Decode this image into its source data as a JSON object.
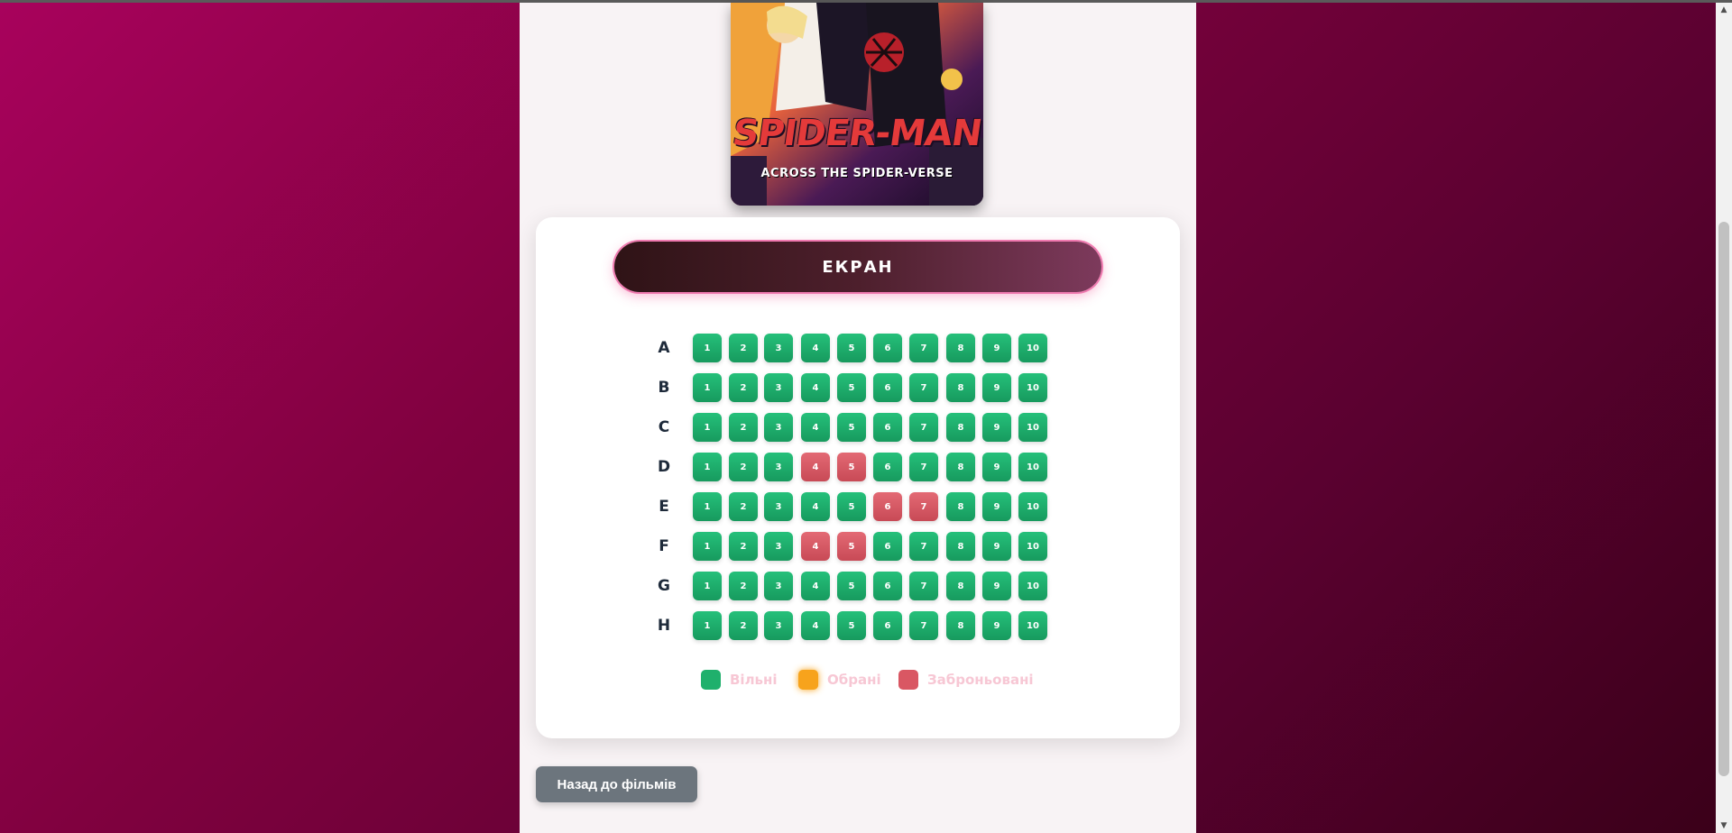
{
  "poster": {
    "title": "SPIDER-MAN",
    "subtitle": "ACROSS THE SPIDER-VERSE"
  },
  "screen_label": "ЕКРАН",
  "rows": [
    {
      "label": "A",
      "seats": [
        {
          "n": "1",
          "status": "free"
        },
        {
          "n": "2",
          "status": "free"
        },
        {
          "n": "3",
          "status": "free"
        },
        {
          "n": "4",
          "status": "free"
        },
        {
          "n": "5",
          "status": "free"
        },
        {
          "n": "6",
          "status": "free"
        },
        {
          "n": "7",
          "status": "free"
        },
        {
          "n": "8",
          "status": "free"
        },
        {
          "n": "9",
          "status": "free"
        },
        {
          "n": "10",
          "status": "free"
        }
      ]
    },
    {
      "label": "B",
      "seats": [
        {
          "n": "1",
          "status": "free"
        },
        {
          "n": "2",
          "status": "free"
        },
        {
          "n": "3",
          "status": "free"
        },
        {
          "n": "4",
          "status": "free"
        },
        {
          "n": "5",
          "status": "free"
        },
        {
          "n": "6",
          "status": "free"
        },
        {
          "n": "7",
          "status": "free"
        },
        {
          "n": "8",
          "status": "free"
        },
        {
          "n": "9",
          "status": "free"
        },
        {
          "n": "10",
          "status": "free"
        }
      ]
    },
    {
      "label": "C",
      "seats": [
        {
          "n": "1",
          "status": "free"
        },
        {
          "n": "2",
          "status": "free"
        },
        {
          "n": "3",
          "status": "free"
        },
        {
          "n": "4",
          "status": "free"
        },
        {
          "n": "5",
          "status": "free"
        },
        {
          "n": "6",
          "status": "free"
        },
        {
          "n": "7",
          "status": "free"
        },
        {
          "n": "8",
          "status": "free"
        },
        {
          "n": "9",
          "status": "free"
        },
        {
          "n": "10",
          "status": "free"
        }
      ]
    },
    {
      "label": "D",
      "seats": [
        {
          "n": "1",
          "status": "free"
        },
        {
          "n": "2",
          "status": "free"
        },
        {
          "n": "3",
          "status": "free"
        },
        {
          "n": "4",
          "status": "booked"
        },
        {
          "n": "5",
          "status": "booked"
        },
        {
          "n": "6",
          "status": "free"
        },
        {
          "n": "7",
          "status": "free"
        },
        {
          "n": "8",
          "status": "free"
        },
        {
          "n": "9",
          "status": "free"
        },
        {
          "n": "10",
          "status": "free"
        }
      ]
    },
    {
      "label": "E",
      "seats": [
        {
          "n": "1",
          "status": "free"
        },
        {
          "n": "2",
          "status": "free"
        },
        {
          "n": "3",
          "status": "free"
        },
        {
          "n": "4",
          "status": "free"
        },
        {
          "n": "5",
          "status": "free"
        },
        {
          "n": "6",
          "status": "booked"
        },
        {
          "n": "7",
          "status": "booked"
        },
        {
          "n": "8",
          "status": "free"
        },
        {
          "n": "9",
          "status": "free"
        },
        {
          "n": "10",
          "status": "free"
        }
      ]
    },
    {
      "label": "F",
      "seats": [
        {
          "n": "1",
          "status": "free"
        },
        {
          "n": "2",
          "status": "free"
        },
        {
          "n": "3",
          "status": "free"
        },
        {
          "n": "4",
          "status": "booked"
        },
        {
          "n": "5",
          "status": "booked"
        },
        {
          "n": "6",
          "status": "free"
        },
        {
          "n": "7",
          "status": "free"
        },
        {
          "n": "8",
          "status": "free"
        },
        {
          "n": "9",
          "status": "free"
        },
        {
          "n": "10",
          "status": "free"
        }
      ]
    },
    {
      "label": "G",
      "seats": [
        {
          "n": "1",
          "status": "free"
        },
        {
          "n": "2",
          "status": "free"
        },
        {
          "n": "3",
          "status": "free"
        },
        {
          "n": "4",
          "status": "free"
        },
        {
          "n": "5",
          "status": "free"
        },
        {
          "n": "6",
          "status": "free"
        },
        {
          "n": "7",
          "status": "free"
        },
        {
          "n": "8",
          "status": "free"
        },
        {
          "n": "9",
          "status": "free"
        },
        {
          "n": "10",
          "status": "free"
        }
      ]
    },
    {
      "label": "H",
      "seats": [
        {
          "n": "1",
          "status": "free"
        },
        {
          "n": "2",
          "status": "free"
        },
        {
          "n": "3",
          "status": "free"
        },
        {
          "n": "4",
          "status": "free"
        },
        {
          "n": "5",
          "status": "free"
        },
        {
          "n": "6",
          "status": "free"
        },
        {
          "n": "7",
          "status": "free"
        },
        {
          "n": "8",
          "status": "free"
        },
        {
          "n": "9",
          "status": "free"
        },
        {
          "n": "10",
          "status": "free"
        }
      ]
    }
  ],
  "legend": {
    "free_label": "Вільні",
    "selected_label": "Обрані",
    "booked_label": "Заброньовані",
    "free_color": "#1fb06c",
    "selected_color": "#f7a31c",
    "booked_color": "#d95763"
  },
  "back_button_label": "Назад до фільмів"
}
